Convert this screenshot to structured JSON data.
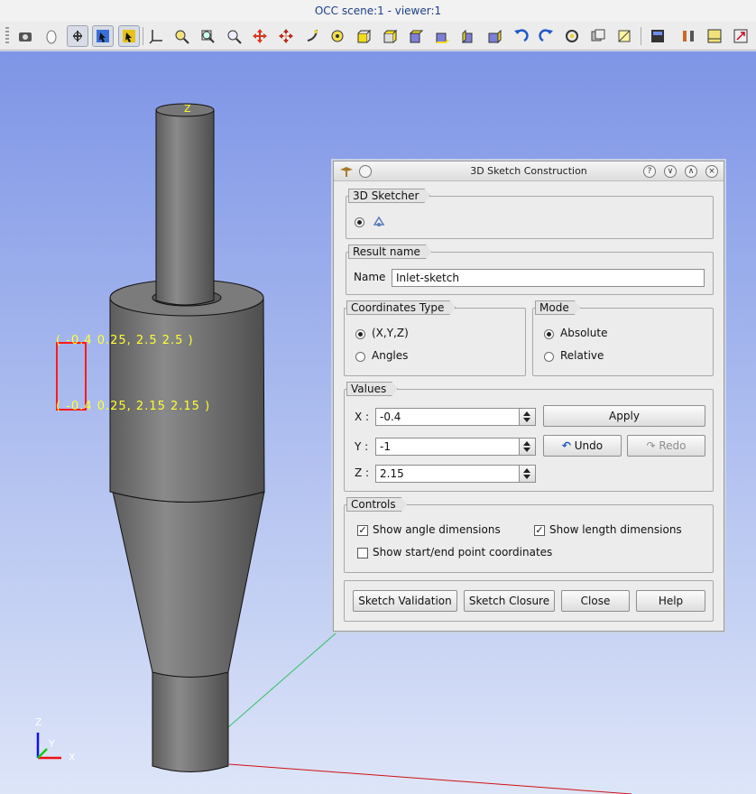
{
  "window": {
    "title": "OCC scene:1 - viewer:1"
  },
  "toolbar": {
    "icons": [
      "dump-view-icon",
      "mouse-icon",
      "trihedron-icon",
      "select-icon",
      "preselect-icon",
      "axes-icon",
      "fit-all-icon",
      "fit-area-icon",
      "zoom-icon",
      "pan-icon",
      "global-pan-icon",
      "rotate-icon",
      "reset-icon",
      "front-icon",
      "back-icon",
      "top-icon",
      "bottom-icon",
      "left-icon",
      "right-icon",
      "rotate-ccw-icon",
      "rotate-cw-icon",
      "orbit-icon",
      "clone-view-icon",
      "clipping-icon",
      "graduated-axes-icon",
      "ray-tracing-icon",
      "environment-icon",
      "maximize-icon"
    ]
  },
  "viewport": {
    "top_marker": "Z",
    "dim_label_top": "( -0.4 0.25, 2.5  2.5 )",
    "dim_label_bottom": "( -0.4 0.25, 2.15 2.15 )",
    "axes": {
      "x": "X",
      "y": "Y",
      "z": "Z"
    },
    "colors": {
      "body": "#6e6e6e",
      "sketch_line": "#ff1a1a",
      "dim_text": "#ffff33",
      "axis_x": "#e11",
      "axis_y": "#1c1",
      "axis_z": "#11e"
    }
  },
  "dialog": {
    "title": "3D Sketch Construction",
    "title_buttons": {
      "help": "?",
      "minimize": "∨",
      "maximize": "∧",
      "close": "×"
    },
    "sketcher": {
      "label": "3D Sketcher",
      "selected": true
    },
    "result_name": {
      "label": "Result name",
      "field_label": "Name",
      "value": "Inlet-sketch"
    },
    "coordinates_type": {
      "label": "Coordinates Type",
      "options": [
        {
          "label": "(X,Y,Z)",
          "selected": true
        },
        {
          "label": "Angles",
          "selected": false
        }
      ]
    },
    "mode": {
      "label": "Mode",
      "options": [
        {
          "label": "Absolute",
          "selected": true
        },
        {
          "label": "Relative",
          "selected": false
        }
      ]
    },
    "values": {
      "label": "Values",
      "x_label": "X :",
      "x": "-0.4",
      "y_label": "Y :",
      "y": "-1",
      "z_label": "Z :",
      "z": "2.15",
      "apply": "Apply",
      "undo": "Undo",
      "redo": "Redo"
    },
    "controls": {
      "label": "Controls",
      "show_angle": {
        "label": "Show angle dimensions",
        "checked": true
      },
      "show_length": {
        "label": "Show length dimensions",
        "checked": true
      },
      "show_start_end": {
        "label": "Show start/end point coordinates",
        "checked": false
      }
    },
    "buttons": {
      "validation": "Sketch Validation",
      "closure": "Sketch Closure",
      "close": "Close",
      "help": "Help"
    }
  }
}
